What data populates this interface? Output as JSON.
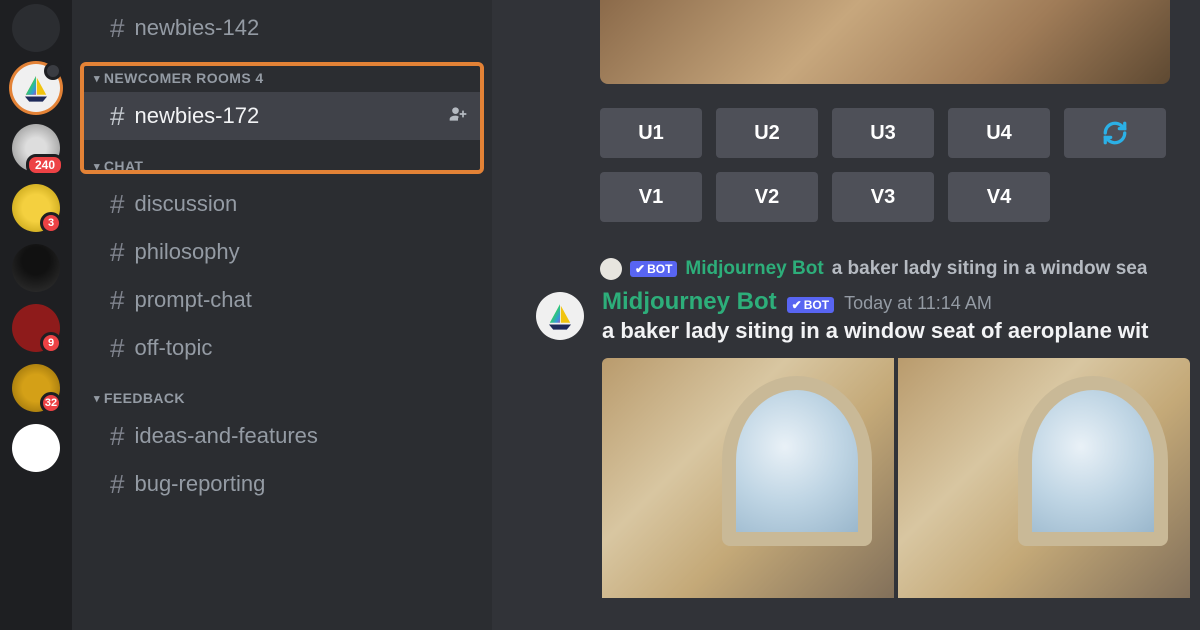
{
  "servers": [
    {
      "badge": ""
    },
    {
      "badge": "",
      "selected": true,
      "kind": "midjourney"
    },
    {
      "badge": "240"
    },
    {
      "badge": "3"
    },
    {
      "badge": ""
    },
    {
      "badge": "9"
    },
    {
      "badge": "32"
    },
    {
      "badge": ""
    }
  ],
  "sidebar": {
    "top_channel": "newbies-142",
    "cat_newcomer": "NEWCOMER ROOMS 4",
    "active_channel": "newbies-172",
    "cat_chat": "CHAT",
    "chat_channels": [
      "discussion",
      "philosophy",
      "prompt-chat",
      "off-topic"
    ],
    "cat_feedback": "FEEDBACK",
    "feedback_channels": [
      "ideas-and-features",
      "bug-reporting"
    ]
  },
  "buttons": {
    "u": [
      "U1",
      "U2",
      "U3",
      "U4"
    ],
    "v": [
      "V1",
      "V2",
      "V3",
      "V4"
    ]
  },
  "bot_tag": "BOT",
  "reply": {
    "author": "Midjourney Bot",
    "text": "a baker lady siting in a window sea"
  },
  "message": {
    "author": "Midjourney Bot",
    "timestamp": "Today at 11:14 AM",
    "prompt": "a baker lady siting in a window seat of aeroplane wit"
  }
}
